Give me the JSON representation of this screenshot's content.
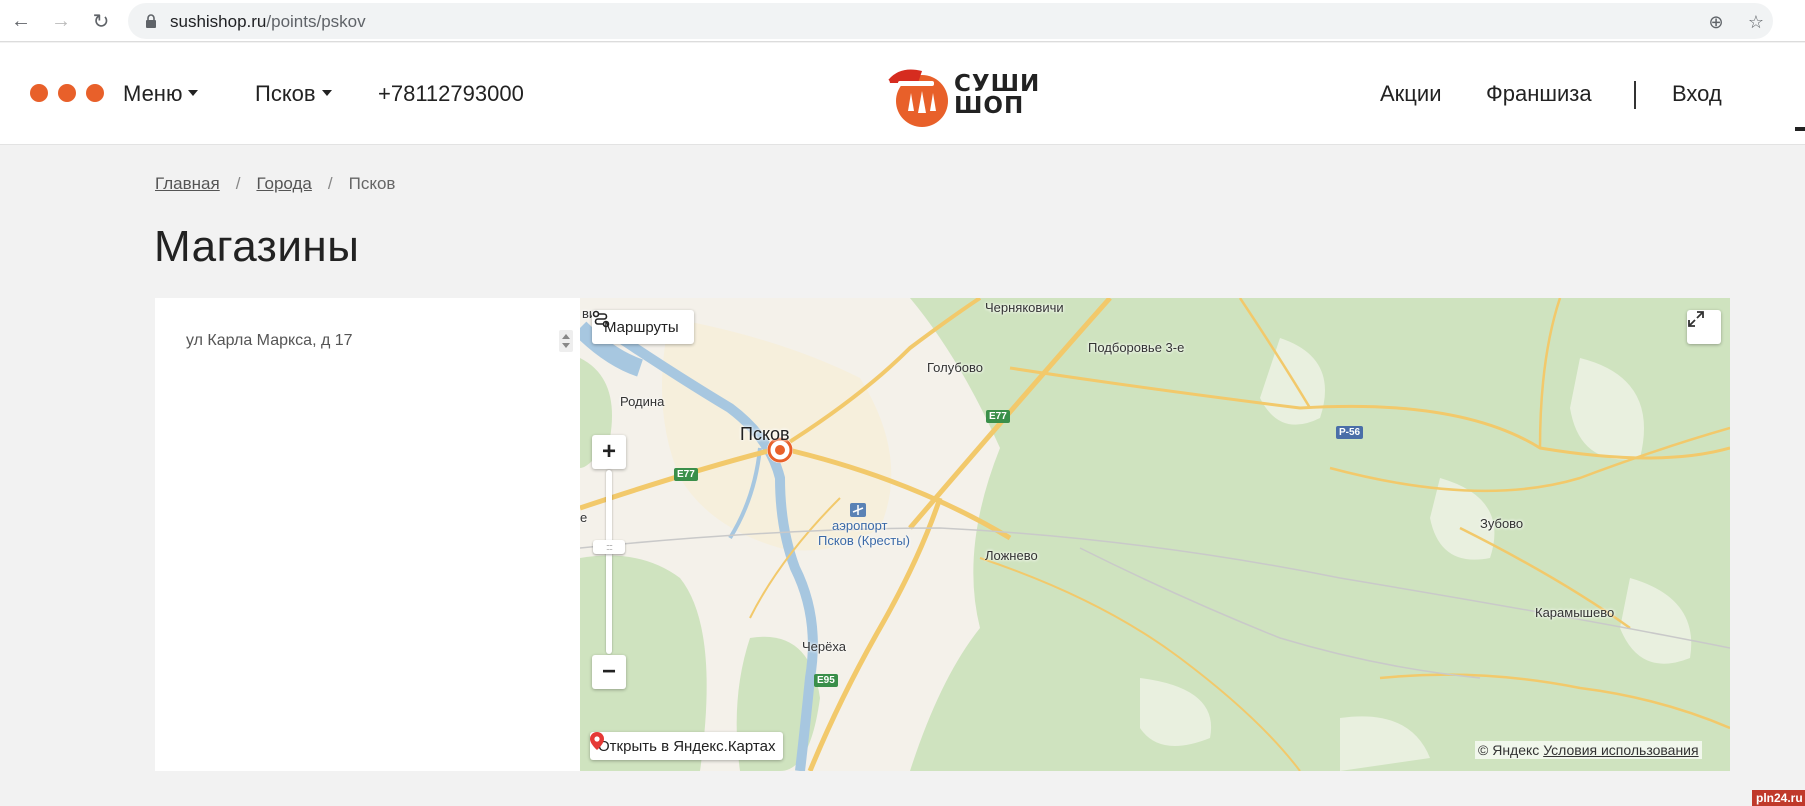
{
  "browser": {
    "url_domain": "sushishop.ru",
    "url_path": "/points/pskov"
  },
  "header": {
    "menu_label": "Меню",
    "city_label": "Псков",
    "phone": "+78112793000",
    "logo_line1": "СУШИ",
    "logo_line2": "ШОП",
    "promo_label": "Акции",
    "franchise_label": "Франшиза",
    "login_label": "Вход",
    "brand_color": "#e8602a"
  },
  "breadcrumb": {
    "home": "Главная",
    "cities": "Города",
    "current": "Псков",
    "separator": "/"
  },
  "page_title": "Магазины",
  "stores": [
    {
      "address": "ул Карла Маркса, д 17"
    }
  ],
  "map": {
    "routes_label": "Маршруты",
    "open_yandex_label": "Открыть в Яндекс.Картах",
    "copyright": "© Яндекс",
    "terms_label": "Условия использования",
    "places": {
      "pskov": "Псков",
      "chernyakovichi": "Черняковичи",
      "podborovye": "Подборовье 3-е",
      "golubovo": "Голубово",
      "rodina": "Родина",
      "airport_line1": "аэропорт",
      "airport_line2": "Псков (Кресты)",
      "lozhnevo": "Ложнево",
      "zubovo": "Зубово",
      "karamyshevo": "Карамышево",
      "cherekha": "Черёха",
      "vi": "ви",
      "e": "е"
    },
    "roads": {
      "e77_a": "E77",
      "e77_b": "E77",
      "r56": "Р-56",
      "e95": "E95"
    }
  },
  "watermark": "pln24.ru"
}
